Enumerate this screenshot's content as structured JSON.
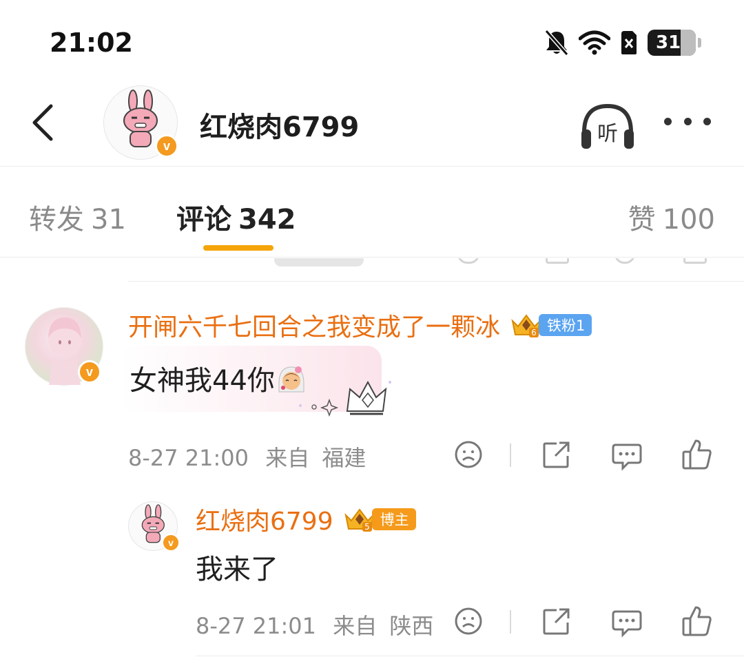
{
  "status_bar": {
    "time": "21:02",
    "battery_level": "31",
    "icons": [
      "bell-off-icon",
      "wifi-icon",
      "sim-off-icon",
      "battery-icon"
    ]
  },
  "header": {
    "title": "红烧肉6799",
    "listen_label": "听",
    "icons": [
      "back-icon",
      "headphones-icon",
      "more-icon"
    ]
  },
  "tabs": [
    {
      "label": "转发",
      "count": "31"
    },
    {
      "label": "评论",
      "count": "342"
    },
    {
      "label": "赞",
      "count": "100"
    }
  ],
  "comments": [
    {
      "username": "开闸六千七回合之我变成了一颗冰",
      "badge_level": "6",
      "fan_tag": "铁粉1",
      "text": "女神我44你",
      "date": "8-27 21:00",
      "source_prefix": "来自",
      "location": "福建"
    }
  ],
  "reply": {
    "username": "红烧肉6799",
    "badge_level": "5",
    "role_tag": "博主",
    "text": "我来了",
    "date": "8-27 21:01",
    "source_prefix": "来自",
    "location": "陕西"
  },
  "verified_badge": "v",
  "colors": {
    "accent_orange": "#e96f11",
    "tab_underline": "#f5a50a",
    "fan_tag_blue": "#5ba4f0",
    "blogger_tag_orange": "#f59a1a",
    "verified_badge": "#f39a1f"
  }
}
